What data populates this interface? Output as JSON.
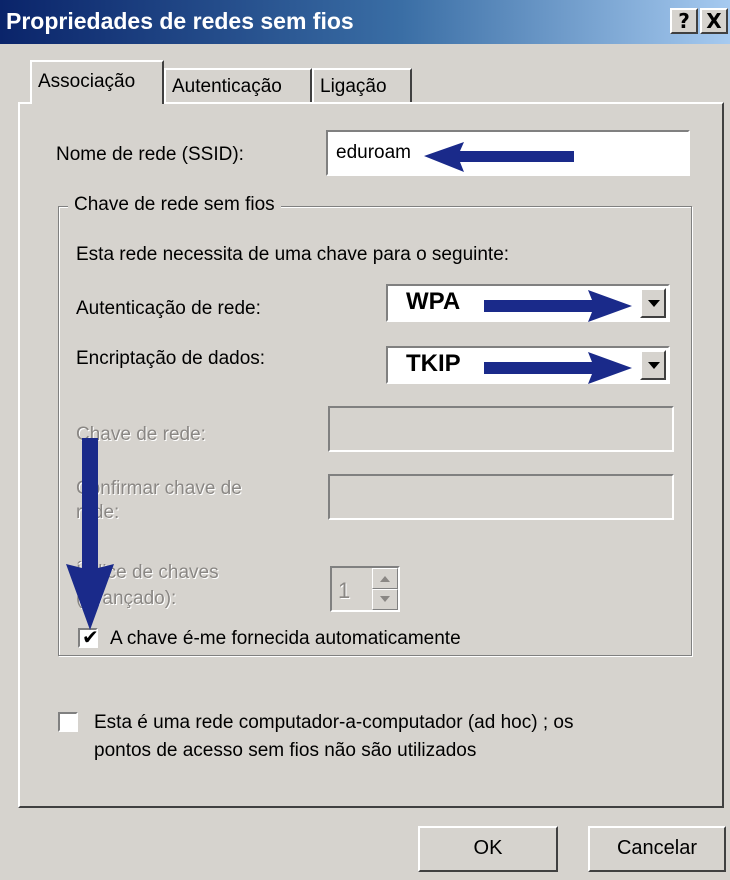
{
  "window": {
    "title": "Propriedades de redes sem fios",
    "help_label": "?",
    "close_label": "X"
  },
  "tabs": [
    {
      "label": "Associação",
      "active": true
    },
    {
      "label": "Autenticação",
      "active": false
    },
    {
      "label": "Ligação",
      "active": false
    }
  ],
  "ssid": {
    "label": "Nome de rede (SSID):",
    "value": "eduroam"
  },
  "network_key_group": {
    "title": "Chave de rede sem fios",
    "description": "Esta rede necessita de uma chave para o seguinte:",
    "auth_label": "Autenticação de rede:",
    "auth_value": "WPA",
    "encryption_label": "Encriptação de dados:",
    "encryption_value": "TKIP",
    "network_key_label": "Chave de rede:",
    "confirm_key_label_line1": "Confirmar chave de",
    "confirm_key_label_line2": "rede:",
    "key_index_label_line1": "Índice de chaves",
    "key_index_label_line2": "(avançado):",
    "key_index_value": "1",
    "auto_key_label": "A chave é-me fornecida automaticamente",
    "auto_key_checked": true
  },
  "adhoc": {
    "label_line1": "Esta é uma rede computador-a-computador (ad hoc) ; os",
    "label_line2": "pontos de acesso sem fios não são utilizados",
    "checked": false
  },
  "buttons": {
    "ok": "OK",
    "cancel": "Cancelar"
  },
  "colors": {
    "annotation_arrow": "#1a2a8a",
    "title_gradient_start": "#0a246a",
    "window_face": "#d6d3ce"
  }
}
